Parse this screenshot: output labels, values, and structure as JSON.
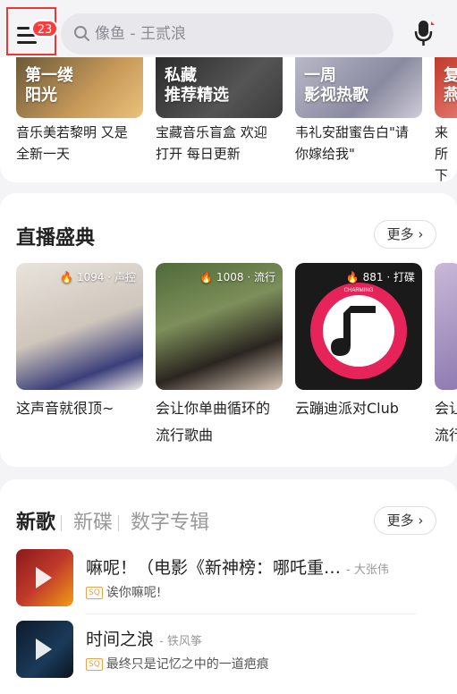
{
  "header": {
    "badge_count": "23",
    "search_placeholder": "像鱼 - 王贰浪"
  },
  "playlists": [
    {
      "tile_line1": "第一缕",
      "tile_line2": "阳光",
      "caption1": "音乐美若黎明 又是",
      "caption2": "全新一天"
    },
    {
      "tile_line1": "私藏",
      "tile_line2": "推荐精选",
      "caption1": "宝藏音乐盲盒 欢迎",
      "caption2": "打开 每日更新"
    },
    {
      "tile_line1": "一周",
      "tile_line2": "影视热歌",
      "caption1": "韦礼安甜蜜告白\"请",
      "caption2": "你嫁给我\""
    },
    {
      "tile_line1": "复",
      "tile_line2": "燕",
      "caption1": "来所",
      "caption2": "下"
    }
  ],
  "live": {
    "title": "直播盛典",
    "more_label": "更多",
    "items": [
      {
        "count": "1094",
        "tag": "声控",
        "caption1": "这声音就很顶~",
        "caption2": ""
      },
      {
        "count": "1008",
        "tag": "流行",
        "caption1": "会让你单曲循环的",
        "caption2": "流行歌曲"
      },
      {
        "count": "881",
        "tag": "打碟",
        "caption1": "云蹦迪派对Club",
        "caption2": ""
      },
      {
        "count": "",
        "tag": "",
        "caption1": "会让",
        "caption2": "流行"
      }
    ]
  },
  "songs": {
    "tabs": [
      "新歌",
      "新碟",
      "数字专辑"
    ],
    "more_label": "更多",
    "items": [
      {
        "title": "嘛呢！（电影《新神榜：哪吒重…",
        "artist": "- 大张伟",
        "quality": "SQ",
        "subtitle": "诶你嘛呢!"
      },
      {
        "title": "时间之浪",
        "artist": "- 铁风筝",
        "quality": "SQ",
        "subtitle": "最终只是记忆之中的一道疤痕"
      }
    ]
  },
  "colors": {
    "accent": "#e53935",
    "badge": "#ff3b3b",
    "sq": "#e8a34a"
  }
}
